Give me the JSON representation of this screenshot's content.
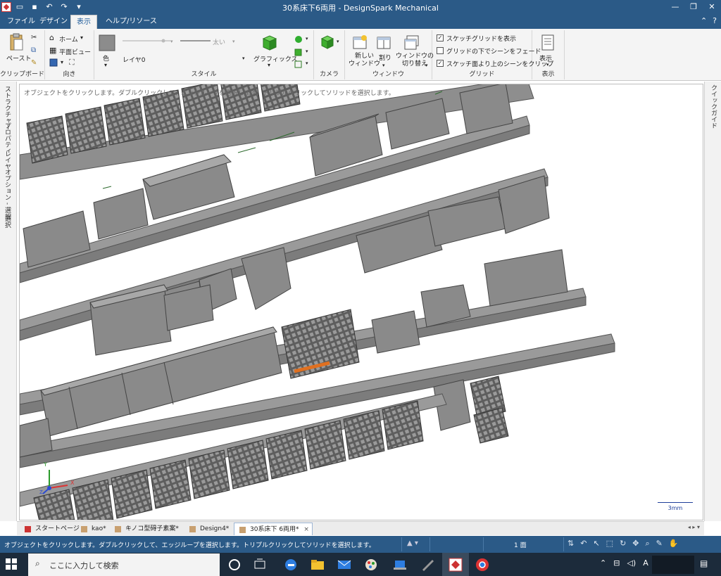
{
  "window": {
    "title": "30系床下6両用 - DesignSpark  Mechanical",
    "minimize": "—",
    "restore": "❐",
    "close": "✕"
  },
  "ribbon_tabs": [
    "ファイル",
    "デザイン",
    "表示",
    "ヘルプ/リソース"
  ],
  "ribbon_right": {
    "collapse": "⌃",
    "help": "?"
  },
  "ribbon": {
    "clipboard": {
      "paste": "ペースト",
      "group": "クリップボード"
    },
    "orient": {
      "home": "ホーム",
      "plane_view": "平面ビュー",
      "group": "向き"
    },
    "style": {
      "color": "色",
      "layer": "レイヤ0",
      "thick": "太い",
      "graphics": "グラフィックス",
      "group": "スタイル"
    },
    "camera": {
      "group": "カメラ"
    },
    "window": {
      "new_window": "新しい\nウィンドウ",
      "split": "割り",
      "switch_window": "ウィンドウの\n切り替え",
      "group": "ウィンドウ"
    },
    "grid": {
      "show_sketch_grid": "スケッチグリッドを表示",
      "fade_scene_under_grid": "グリッドの下でシーンをフェード",
      "clip_scene_above_sketch": "スケッチ面より上のシーンをクリップ",
      "group": "グリッド",
      "checked": [
        true,
        false,
        true
      ]
    },
    "display": {
      "show": "表示",
      "group": "表示"
    }
  },
  "left_panel_tabs": [
    "ストラクチャー",
    "プロパティ",
    "レイヤ",
    "オプション - 選択",
    "選択"
  ],
  "right_panel_tabs": [
    "クイックガイド"
  ],
  "viewport": {
    "hint": "オブジェクトをクリックします。ダブルクリックして、エッジループを選択します。トリプルクリックしてソリッドを選択します。",
    "scale_label": "3mm",
    "axis_x": "X",
    "axis_y": "Y",
    "axis_z": "Z"
  },
  "doc_tabs": [
    {
      "label": "スタートページ",
      "active": false
    },
    {
      "label": "kao*",
      "active": false
    },
    {
      "label": "キノコ型碍子素案*",
      "active": false
    },
    {
      "label": "Design4*",
      "active": false
    },
    {
      "label": "30系床下 6両用*",
      "active": true
    }
  ],
  "doc_tab_close": "×",
  "status": {
    "message": "オブジェクトをクリックします。ダブルクリックして、エッジループを選択します。トリプルクリックしてソリッドを選択します。",
    "faces": "1 面"
  },
  "taskbar": {
    "search_placeholder": "ここに入力して検索",
    "ime": "A"
  },
  "colors": {
    "titlebar": "#2b5a87",
    "ribbon": "#f4f4f4",
    "part_fill": "#8c8c8c",
    "part_top": "#a6a6a6",
    "highlight": "#e07020",
    "taskbar": "#1c2b3b"
  }
}
